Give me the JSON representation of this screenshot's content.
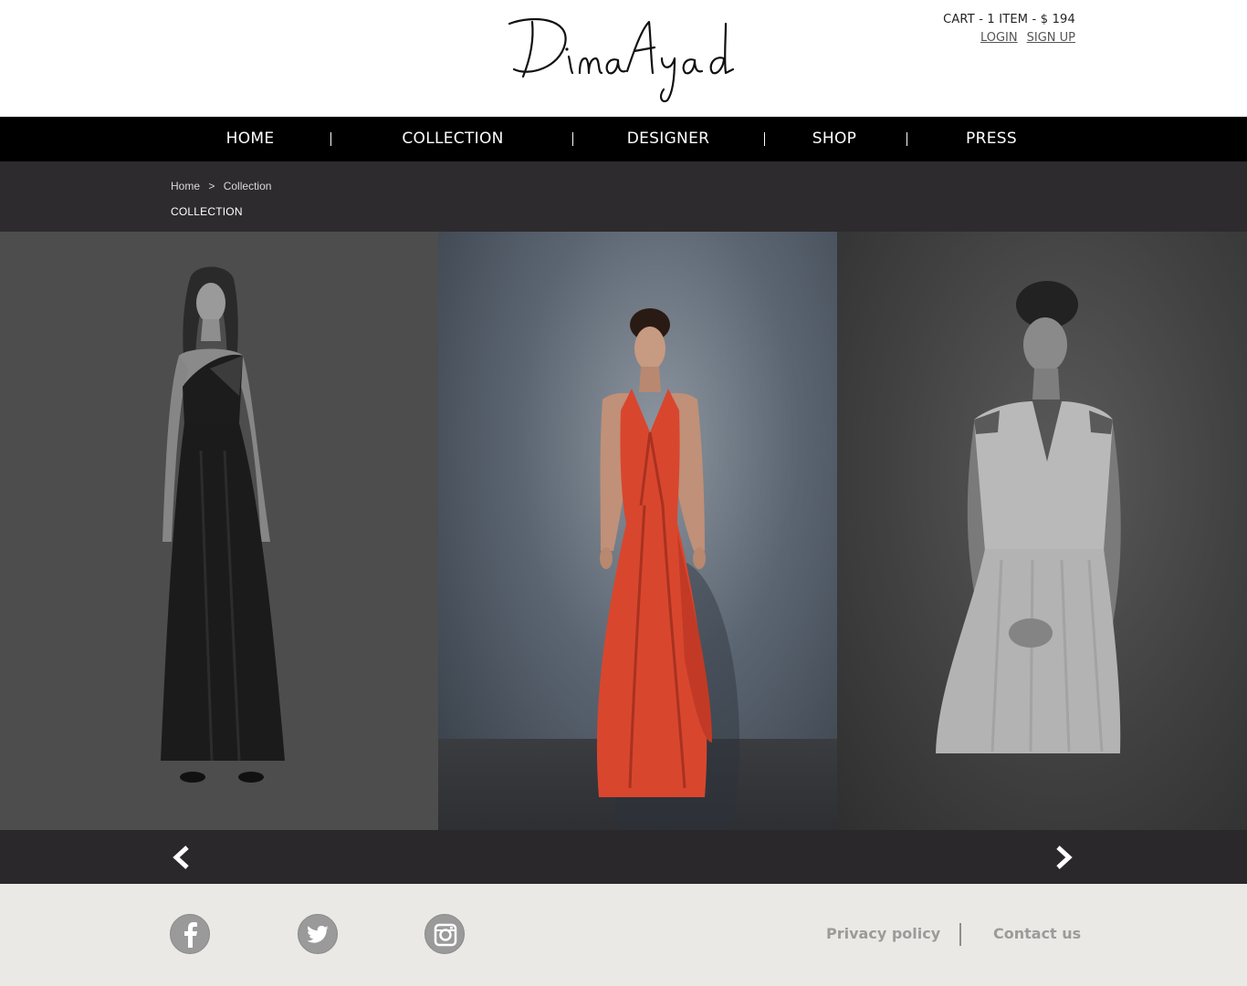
{
  "header": {
    "logo_alt": "Dima Ayad",
    "cart_text": "CART - 1 ITEM - $ 194",
    "login_label": "LOGIN",
    "signup_label": "SIGN UP"
  },
  "nav": {
    "items": [
      {
        "label": "HOME"
      },
      {
        "label": "COLLECTION"
      },
      {
        "label": "DESIGNER"
      },
      {
        "label": "SHOP"
      },
      {
        "label": "PRESS"
      }
    ]
  },
  "breadcrumb": {
    "items": [
      "Home",
      ">",
      "Collection"
    ],
    "page_title": "COLLECTION"
  },
  "gallery": {
    "slides": [
      {
        "name": "black one-shoulder gown",
        "state": "dimmed"
      },
      {
        "name": "red halter draped gown",
        "state": "active"
      },
      {
        "name": "white embellished-shoulder dress",
        "state": "dimmed"
      }
    ],
    "prev_icon": "chevron-left-icon",
    "next_icon": "chevron-right-icon"
  },
  "footer": {
    "social": [
      "facebook-icon",
      "twitter-icon",
      "instagram-icon"
    ],
    "privacy_label": "Privacy policy",
    "contact_label": "Contact us"
  },
  "colors": {
    "nav_bg": "#000000",
    "crumb_bg": "#2d2b2e",
    "footer_bg": "#ebe9e5",
    "dress_red": "#d9462e"
  }
}
